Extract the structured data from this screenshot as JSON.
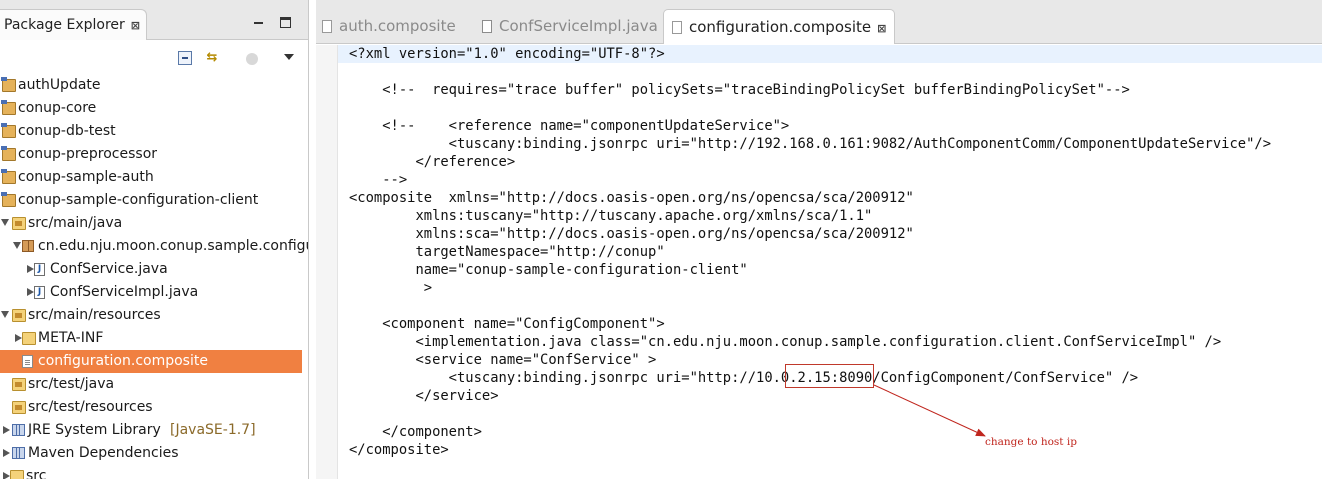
{
  "package_explorer": {
    "title": "Package Explorer",
    "close_glyph": "⊠",
    "tree": [
      {
        "label": "authUpdate",
        "icon": "project-icon",
        "expanded": null,
        "selected": false
      },
      {
        "label": "conup-core",
        "icon": "project-icon",
        "expanded": null,
        "selected": false
      },
      {
        "label": "conup-db-test",
        "icon": "project-icon",
        "expanded": null,
        "selected": false
      },
      {
        "label": "conup-preprocessor",
        "icon": "project-icon",
        "expanded": null,
        "selected": false
      },
      {
        "label": "conup-sample-auth",
        "icon": "project-icon",
        "expanded": null,
        "selected": false
      },
      {
        "label": "conup-sample-configuration-client",
        "icon": "project-icon",
        "expanded": null,
        "selected": false
      },
      {
        "label": "src/main/java",
        "icon": "source-folder-icon",
        "expanded": true,
        "selected": false
      },
      {
        "label": "cn.edu.nju.moon.conup.sample.configu",
        "icon": "package-icon",
        "expanded": true,
        "selected": false
      },
      {
        "label": "ConfService.java",
        "icon": "java-file-icon",
        "expanded": false,
        "selected": false
      },
      {
        "label": "ConfServiceImpl.java",
        "icon": "java-file-icon",
        "expanded": false,
        "selected": false
      },
      {
        "label": "src/main/resources",
        "icon": "source-folder-icon",
        "expanded": true,
        "selected": false
      },
      {
        "label": "META-INF",
        "icon": "folder-icon",
        "expanded": false,
        "selected": false
      },
      {
        "label": "configuration.composite",
        "icon": "file-icon",
        "expanded": null,
        "selected": true
      },
      {
        "label": "src/test/java",
        "icon": "source-folder-icon",
        "expanded": null,
        "selected": false
      },
      {
        "label": "src/test/resources",
        "icon": "source-folder-icon",
        "expanded": null,
        "selected": false
      },
      {
        "label": "JRE System Library",
        "suffix": "[JavaSE-1.7]",
        "icon": "library-icon",
        "expanded": false,
        "selected": false
      },
      {
        "label": "Maven Dependencies",
        "icon": "library-icon",
        "expanded": false,
        "selected": false
      },
      {
        "label": "src",
        "icon": "folder-icon",
        "expanded": false,
        "selected": false
      }
    ]
  },
  "editor": {
    "tabs": [
      {
        "label": "auth.composite",
        "active": false
      },
      {
        "label": "ConfServiceImpl.java",
        "active": false
      },
      {
        "label": "configuration.composite",
        "active": true
      }
    ],
    "close_glyph": "⊠",
    "code_lines": [
      "<?xml version=\"1.0\" encoding=\"UTF-8\"?>",
      "",
      "    <!--  requires=\"trace buffer\" policySets=\"traceBindingPolicySet bufferBindingPolicySet\"-->",
      "",
      "    <!--    <reference name=\"componentUpdateService\">",
      "            <tuscany:binding.jsonrpc uri=\"http://192.168.0.161:9082/AuthComponentComm/ComponentUpdateService\"/>",
      "        </reference>",
      "    -->",
      "<composite  xmlns=\"http://docs.oasis-open.org/ns/opencsa/sca/200912\"",
      "        xmlns:tuscany=\"http://tuscany.apache.org/xmlns/sca/1.1\"",
      "        xmlns:sca=\"http://docs.oasis-open.org/ns/opencsa/sca/200912\"",
      "        targetNamespace=\"http://conup\"",
      "        name=\"conup-sample-configuration-client\"",
      "         >",
      "",
      "    <component name=\"ConfigComponent\">",
      "        <implementation.java class=\"cn.edu.nju.moon.conup.sample.configuration.client.ConfServiceImpl\" />",
      "        <service name=\"ConfService\" >",
      "            <tuscany:binding.jsonrpc uri=\"http://10.0.2.15:8090/ConfigComponent/ConfService\" />",
      "        </service>",
      "",
      "    </component>",
      "</composite>"
    ],
    "highlighted_ip": "10.0.2.15",
    "annotation": "change to host ip"
  },
  "colors": {
    "selection": "#f08041",
    "annotation": "#c0261e",
    "current_line": "#e8f2fe"
  }
}
